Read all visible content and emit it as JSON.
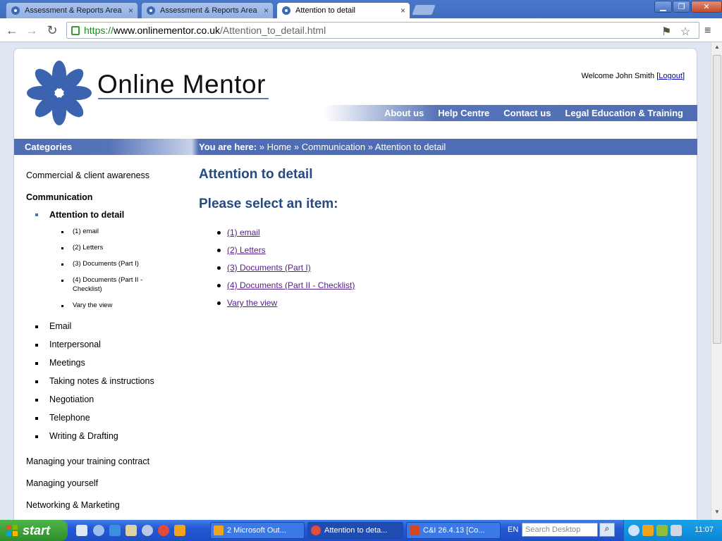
{
  "browser": {
    "tabs": [
      {
        "label": "Assessment & Reports Area",
        "close": "×"
      },
      {
        "label": "Assessment & Reports Area",
        "close": "×"
      },
      {
        "label": "Attention to detail",
        "close": "×"
      }
    ],
    "url": {
      "scheme": "https://",
      "host": "www.onlinementor.co.uk",
      "path": "/Attention_to_detail.html"
    }
  },
  "site": {
    "logo_text": "Online Mentor",
    "welcome": {
      "prefix": "Welcome John Smith [",
      "link": "Logout",
      "suffix": "]"
    },
    "topnav": [
      "About us",
      "Help Centre",
      "Contact us",
      "Legal Education & Training"
    ],
    "categories_title": "Categories",
    "breadcrumb": {
      "prefix": "You are here:",
      "items": [
        "» Home",
        "» Communication",
        "» Attention to detail"
      ]
    }
  },
  "sidebar": {
    "commercial": "Commercial & client awareness",
    "communication": "Communication",
    "attention": "Attention to detail",
    "sub": [
      "(1) email",
      "(2) Letters",
      "(3) Documents (Part I)",
      "(4) Documents (Part II - Checklist)",
      "Vary the view"
    ],
    "comm_items": [
      "Email",
      "Interpersonal",
      "Meetings",
      "Taking notes & instructions",
      "Negotiation",
      "Telephone",
      "Writing & Drafting"
    ],
    "bottom": [
      "Managing your training contract",
      "Managing yourself",
      "Networking & Marketing"
    ]
  },
  "main": {
    "title": "Attention to detail",
    "subtitle": "Please select an item:",
    "items": [
      "(1) email",
      "(2) Letters",
      "(3) Documents (Part I)",
      "(4) Documents (Part II - Checklist)",
      "Vary the view"
    ]
  },
  "taskbar": {
    "start": "start",
    "buttons": [
      "2 Microsoft Out...",
      "Attention to deta...",
      "C&I 26.4.13 [Co..."
    ],
    "language": "EN",
    "search_placeholder": "Search Desktop",
    "clock": "11:07"
  },
  "colors": {
    "brand_blue": "#4e6db4",
    "heading": "#234a84",
    "link_visited": "#551a8b"
  }
}
